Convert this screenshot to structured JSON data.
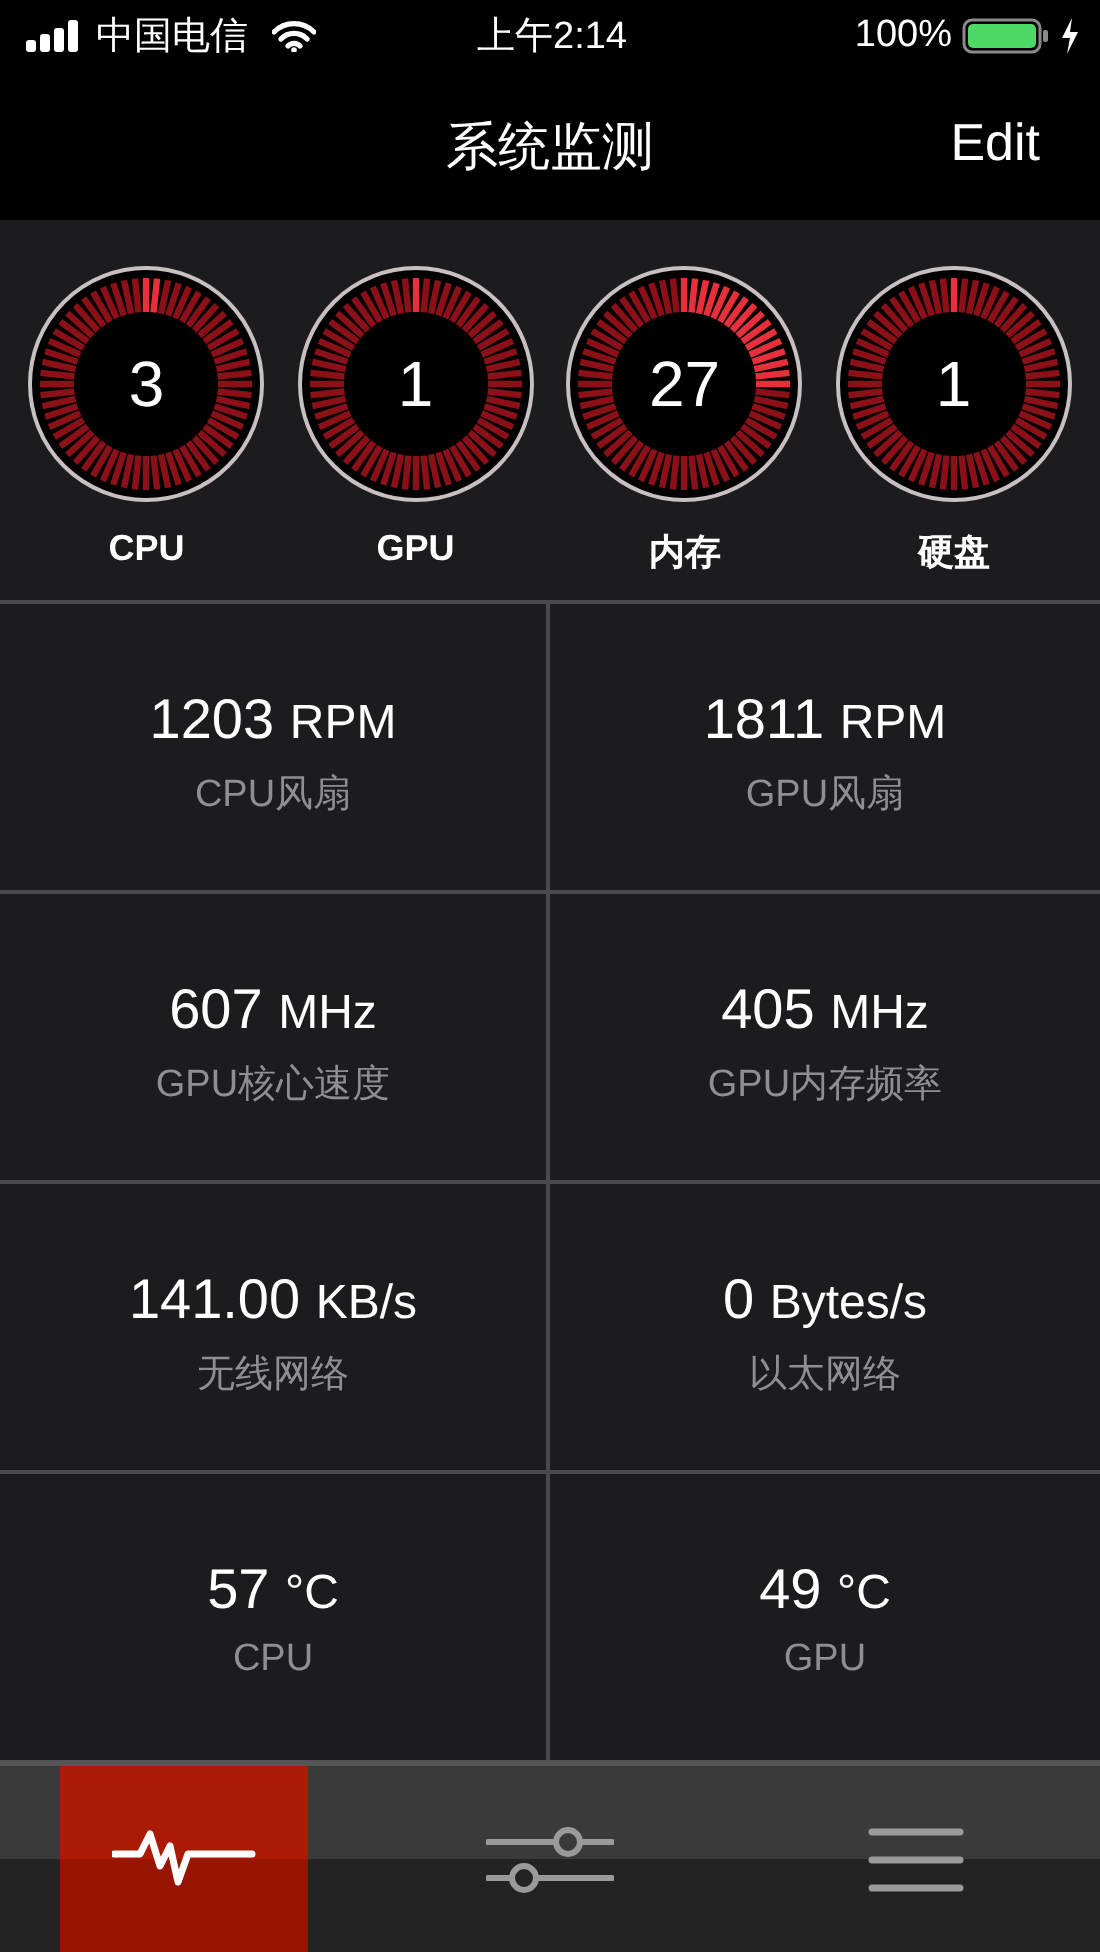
{
  "status_bar": {
    "carrier": "中国电信",
    "time": "上午2:14",
    "battery": "100%"
  },
  "nav": {
    "title": "系统监测",
    "edit": "Edit"
  },
  "gauges": [
    {
      "value": "3",
      "label": "CPU"
    },
    {
      "value": "1",
      "label": "GPU"
    },
    {
      "value": "27",
      "label": "内存"
    },
    {
      "value": "1",
      "label": "硬盘"
    }
  ],
  "metrics": [
    {
      "value": "1203",
      "unit": "RPM",
      "label": "CPU风扇"
    },
    {
      "value": "1811",
      "unit": "RPM",
      "label": "GPU风扇"
    },
    {
      "value": "607",
      "unit": "MHz",
      "label": "GPU核心速度"
    },
    {
      "value": "405",
      "unit": "MHz",
      "label": "GPU内存频率"
    },
    {
      "value": "141.00",
      "unit": "KB/s",
      "label": "无线网络"
    },
    {
      "value": "0",
      "unit": "Bytes/s",
      "label": "以太网络"
    },
    {
      "value": "57",
      "unit": "°C",
      "label": "CPU"
    },
    {
      "value": "49",
      "unit": "°C",
      "label": "GPU"
    }
  ],
  "tabs": [
    {
      "kind": "pulse",
      "selected": true
    },
    {
      "kind": "sliders",
      "selected": false
    },
    {
      "kind": "menu",
      "selected": false
    }
  ]
}
